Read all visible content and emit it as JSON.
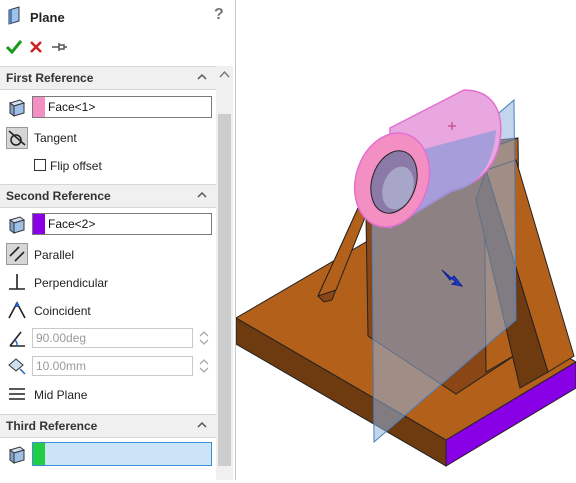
{
  "header": {
    "title": "Plane",
    "help": "?"
  },
  "actions": {
    "ok": "✔",
    "cancel": "✕",
    "pin": "pin"
  },
  "first_reference": {
    "heading": "First Reference",
    "value": "Face<1>",
    "swatch_color": "#f48fc4",
    "tangent_label": "Tangent",
    "flip_offset_label": "Flip offset"
  },
  "second_reference": {
    "heading": "Second Reference",
    "value": "Face<2>",
    "swatch_color": "#8a00e6",
    "parallel_label": "Parallel",
    "perpendicular_label": "Perpendicular",
    "coincident_label": "Coincident",
    "angle_value": "90.00deg",
    "distance_value": "10.00mm",
    "mid_plane_label": "Mid Plane"
  },
  "third_reference": {
    "heading": "Third Reference",
    "value": "",
    "swatch_color": "#22cc44"
  },
  "colors": {
    "part_brown": "#b3601a",
    "part_brown_dark": "#6e3a10",
    "plane_blue": "#8fb3de",
    "face_pink": "#f48fc4",
    "face_purple": "#8a00e6",
    "accent_check": "#1a9a1a",
    "accent_cross": "#d22020"
  }
}
